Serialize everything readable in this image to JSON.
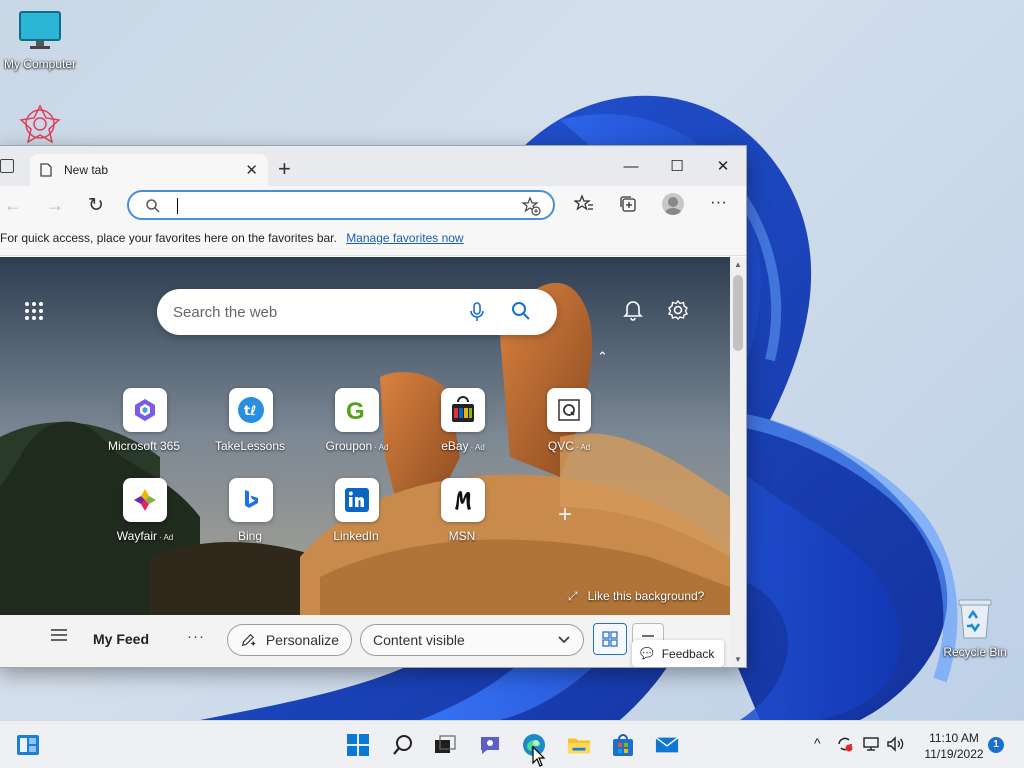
{
  "desktop": {
    "icons": [
      {
        "label": "My Computer",
        "icon": "computer-monitor-icon"
      },
      {
        "label": "",
        "icon": "app-shortcut-icon"
      },
      {
        "label": "Recycle Bin",
        "icon": "recycle-bin-icon"
      }
    ]
  },
  "browser": {
    "tab": {
      "title": "New tab",
      "close": "✕"
    },
    "new_tab": "+",
    "window_controls": {
      "minimize": "—",
      "maximize": "☐",
      "close": "✕"
    },
    "toolbar": {
      "back": "←",
      "forward": "→",
      "refresh": "↻",
      "address_value": "",
      "more": "···"
    },
    "favorites_bar": {
      "text": "For quick access, place your favorites here on the favorites bar.",
      "link": "Manage favorites now"
    }
  },
  "new_tab_page": {
    "search": {
      "placeholder": "Search the web"
    },
    "quick_links": [
      {
        "label": "Microsoft 365",
        "ad": "",
        "icon": "microsoft-365-icon"
      },
      {
        "label": "TakeLessons",
        "ad": "",
        "icon": "takelessons-icon"
      },
      {
        "label": "Groupon",
        "ad": "· Ad",
        "icon": "groupon-icon"
      },
      {
        "label": "eBay",
        "ad": "· Ad",
        "icon": "ebay-icon"
      },
      {
        "label": "QVC",
        "ad": "· Ad",
        "icon": "qvc-icon"
      },
      {
        "label": "Wayfair",
        "ad": "· Ad",
        "icon": "wayfair-icon"
      },
      {
        "label": "Bing",
        "ad": "",
        "icon": "bing-icon"
      },
      {
        "label": "LinkedIn",
        "ad": "",
        "icon": "linkedin-icon"
      },
      {
        "label": "MSN",
        "ad": "",
        "icon": "msn-icon"
      }
    ],
    "add_link": "+",
    "collapse": "⌃",
    "background_prompt": "Like this background?",
    "feed": {
      "title": "My Feed",
      "more": "···",
      "personalize": "Personalize",
      "content_select": "Content visible",
      "feedback": "Feedback"
    }
  },
  "taskbar": {
    "apps": [
      "widgets-icon",
      "start-icon",
      "search-icon",
      "task-view-icon",
      "chat-icon",
      "edge-icon",
      "file-explorer-icon",
      "store-icon",
      "mail-icon"
    ],
    "clock": {
      "time": "11:10 AM",
      "date": "11/19/2022"
    },
    "notifications": "1",
    "tray_chevron": "^"
  },
  "colors": {
    "accent": "#1a6fd0",
    "link": "#1a5fb4",
    "address_border": "#4a8fd6"
  }
}
